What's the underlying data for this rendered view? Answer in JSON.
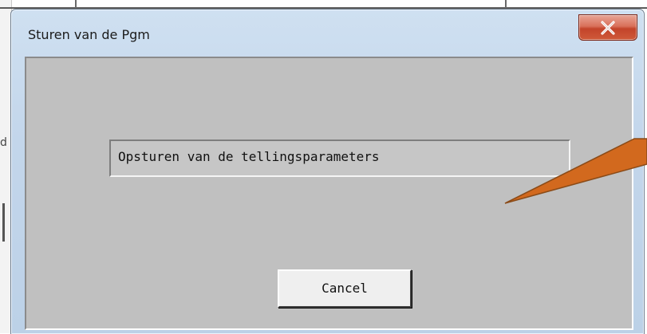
{
  "dialog": {
    "title": "Sturen van de Pgm",
    "status_text": "Opsturen van de tellingsparameters",
    "cancel_label": "Cancel"
  },
  "background": {
    "left_mark": "d"
  },
  "icons": {
    "close": "close-x-icon"
  },
  "colors": {
    "close_button": "#c9503a",
    "dialog_background": "#c0c0c0",
    "title_bar": "#c3d6eb",
    "annotation_arrow": "#d2691e"
  }
}
